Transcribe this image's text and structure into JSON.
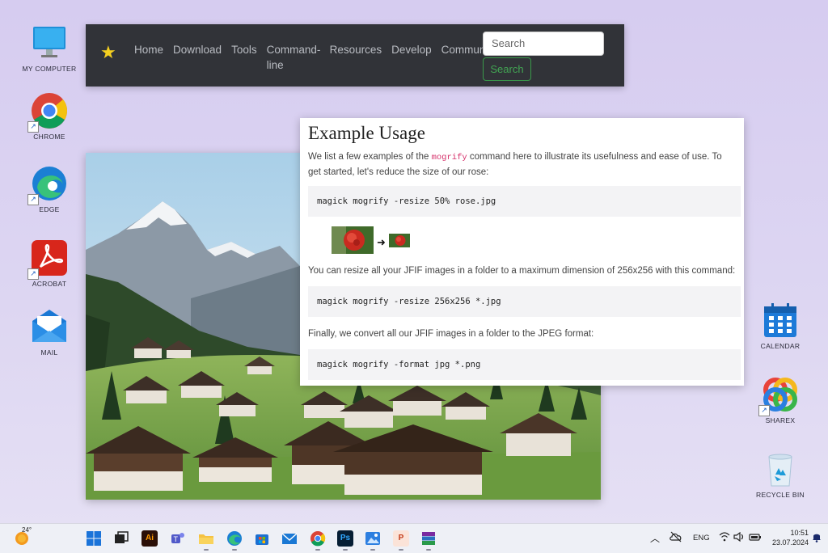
{
  "desktop_left": [
    {
      "label": "MY COMPUTER",
      "icon": "monitor-icon"
    },
    {
      "label": "CHROME",
      "icon": "chrome-icon"
    },
    {
      "label": "EDGE",
      "icon": "edge-icon"
    },
    {
      "label": "ACROBAT",
      "icon": "acrobat-icon"
    },
    {
      "label": "MAIL",
      "icon": "mail-icon"
    }
  ],
  "desktop_right": [
    {
      "label": "CALENDAR",
      "icon": "calendar-icon"
    },
    {
      "label": "SHAREX",
      "icon": "sharex-icon"
    },
    {
      "label": "RECYCLE BIN",
      "icon": "recycle-bin-icon"
    }
  ],
  "navbar": {
    "links": [
      "Home",
      "Download",
      "Tools",
      "Command-line",
      "Resources",
      "Develop",
      "Community"
    ],
    "search_placeholder": "Search",
    "search_button": "Search"
  },
  "doc": {
    "title": "Example Usage",
    "intro_before": "We list a few examples of the ",
    "intro_code": "mogrify",
    "intro_after": " command here to illustrate its usefulness and ease of use. To get started, let's reduce the size of our rose:",
    "code1": "magick mogrify -resize 50% rose.jpg",
    "para2": "You can resize all your  JFIF  images in a folder to a maximum dimension of 256x256 with this command:",
    "code2": "magick mogrify -resize 256x256 *.jpg",
    "para3": "Finally, we convert all our JFIF images in a folder to the JPEG format:",
    "code3": "magick mogrify -format jpg *.png"
  },
  "taskbar": {
    "weather_temp": "24°",
    "language": "ENG",
    "time": "10:51",
    "date": "23.07.2024"
  },
  "colors": {
    "navbar_bg": "#313338",
    "search_green": "#42a553",
    "code_pink": "#d6336c"
  }
}
